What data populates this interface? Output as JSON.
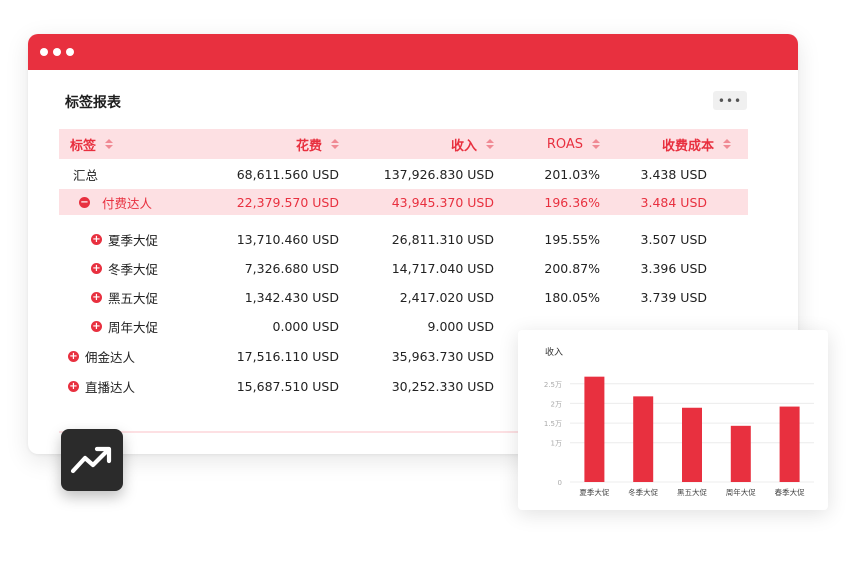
{
  "window": {
    "title": "标签报表",
    "more_label": "•••"
  },
  "table": {
    "headers": [
      "标签",
      "花费",
      "收入",
      "ROAS",
      "收费成本"
    ],
    "rows": [
      {
        "label": "汇总",
        "toggle": "",
        "spend": "68,611.560 USD",
        "revenue": "137,926.830 USD",
        "roas": "201.03%",
        "cost": "3.438 USD"
      },
      {
        "label": "付费达人",
        "toggle": "−",
        "spend": "22,379.570 USD",
        "revenue": "43,945.370 USD",
        "roas": "196.36%",
        "cost": "3.484 USD"
      },
      {
        "label": "夏季大促",
        "toggle": "+",
        "spend": "13,710.460 USD",
        "revenue": "26,811.310 USD",
        "roas": "195.55%",
        "cost": "3.507 USD"
      },
      {
        "label": "冬季大促",
        "toggle": "+",
        "spend": "7,326.680 USD",
        "revenue": "14,717.040 USD",
        "roas": "200.87%",
        "cost": "3.396 USD"
      },
      {
        "label": "黑五大促",
        "toggle": "+",
        "spend": "1,342.430 USD",
        "revenue": "2,417.020 USD",
        "roas": "180.05%",
        "cost": "3.739 USD"
      },
      {
        "label": "周年大促",
        "toggle": "+",
        "spend": "0.000 USD",
        "revenue": "9.000 USD",
        "roas": "",
        "cost": ""
      },
      {
        "label": "佣金达人",
        "toggle": "+",
        "spend": "17,516.110 USD",
        "revenue": "35,963.730 USD",
        "roas": "",
        "cost": ""
      },
      {
        "label": "直播达人",
        "toggle": "+",
        "spend": "15,687.510 USD",
        "revenue": "30,252.330 USD",
        "roas": "",
        "cost": ""
      }
    ]
  },
  "icons": {
    "trend": "trending-up-icon"
  },
  "colors": {
    "accent": "#e8303f",
    "header_bg": "#fde0e3",
    "icon_tile": "#2b2b2b"
  },
  "chart_data": {
    "type": "bar",
    "title": "收入",
    "categories": [
      "夏季大促",
      "冬季大促",
      "黑五大促",
      "周年大促",
      "春季大促"
    ],
    "values": [
      26811,
      21800,
      18900,
      14300,
      19200
    ],
    "yticks": [
      {
        "value": 0,
        "label": "0"
      },
      {
        "value": 10000,
        "label": "1万"
      },
      {
        "value": 15000,
        "label": "1.5万"
      },
      {
        "value": 20000,
        "label": "2万"
      },
      {
        "value": 25000,
        "label": "2.5万"
      }
    ],
    "ylim": [
      0,
      28000
    ],
    "grid": true
  }
}
